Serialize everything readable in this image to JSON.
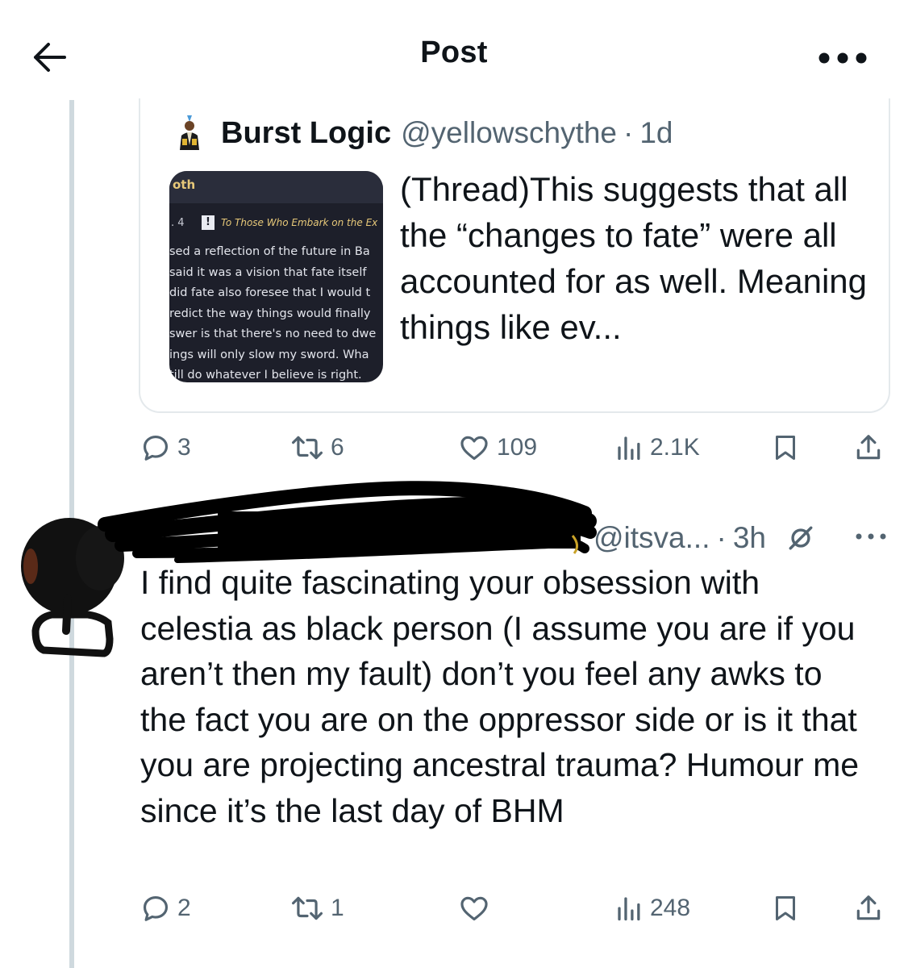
{
  "header": {
    "title": "Post",
    "back_icon": "arrow-left-icon",
    "more_icon": "more-horizontal-icon"
  },
  "quoted_post": {
    "author_name": "Burst Logic",
    "author_handle": "@yellowschythe",
    "separator": "·",
    "time": "1d",
    "text": "(Thread)This suggests that all the “changes to fate” were all accounted for as well. Meaning things like ev...",
    "media": {
      "tab_label": "oth",
      "chapter": ". 4",
      "badge": "!",
      "heading": "To Those Who Embark on the Ex",
      "lines": [
        "sed a reflection of the future in Ba",
        " said it was a vision that fate itself",
        " did fate also foresee that I would t",
        "redict the way things would finally",
        "swer is that there's no need to dwe",
        "ings will only slow my sword. Wha",
        "till do whatever I believe is right."
      ]
    },
    "actions": {
      "replies": "3",
      "reposts": "6",
      "likes": "109",
      "views": "2.1K"
    }
  },
  "reply_post": {
    "author_handle": "@itsva...",
    "separator": "·",
    "time": "3h",
    "text": "I find quite fascinating your obsession with celestia as black person (I assume you are if you aren’t then my fault)  don’t you feel any awks to the fact you are on the oppressor side or is it that you are projecting ancestral trauma? Humour me since it’s the last day of BHM",
    "actions": {
      "replies": "2",
      "reposts": "1",
      "likes": "",
      "views": "248"
    }
  },
  "colors": {
    "text_primary": "#0f1419",
    "text_secondary": "#536471",
    "border": "#e4e9ec",
    "thread_line": "#cfd9de"
  }
}
